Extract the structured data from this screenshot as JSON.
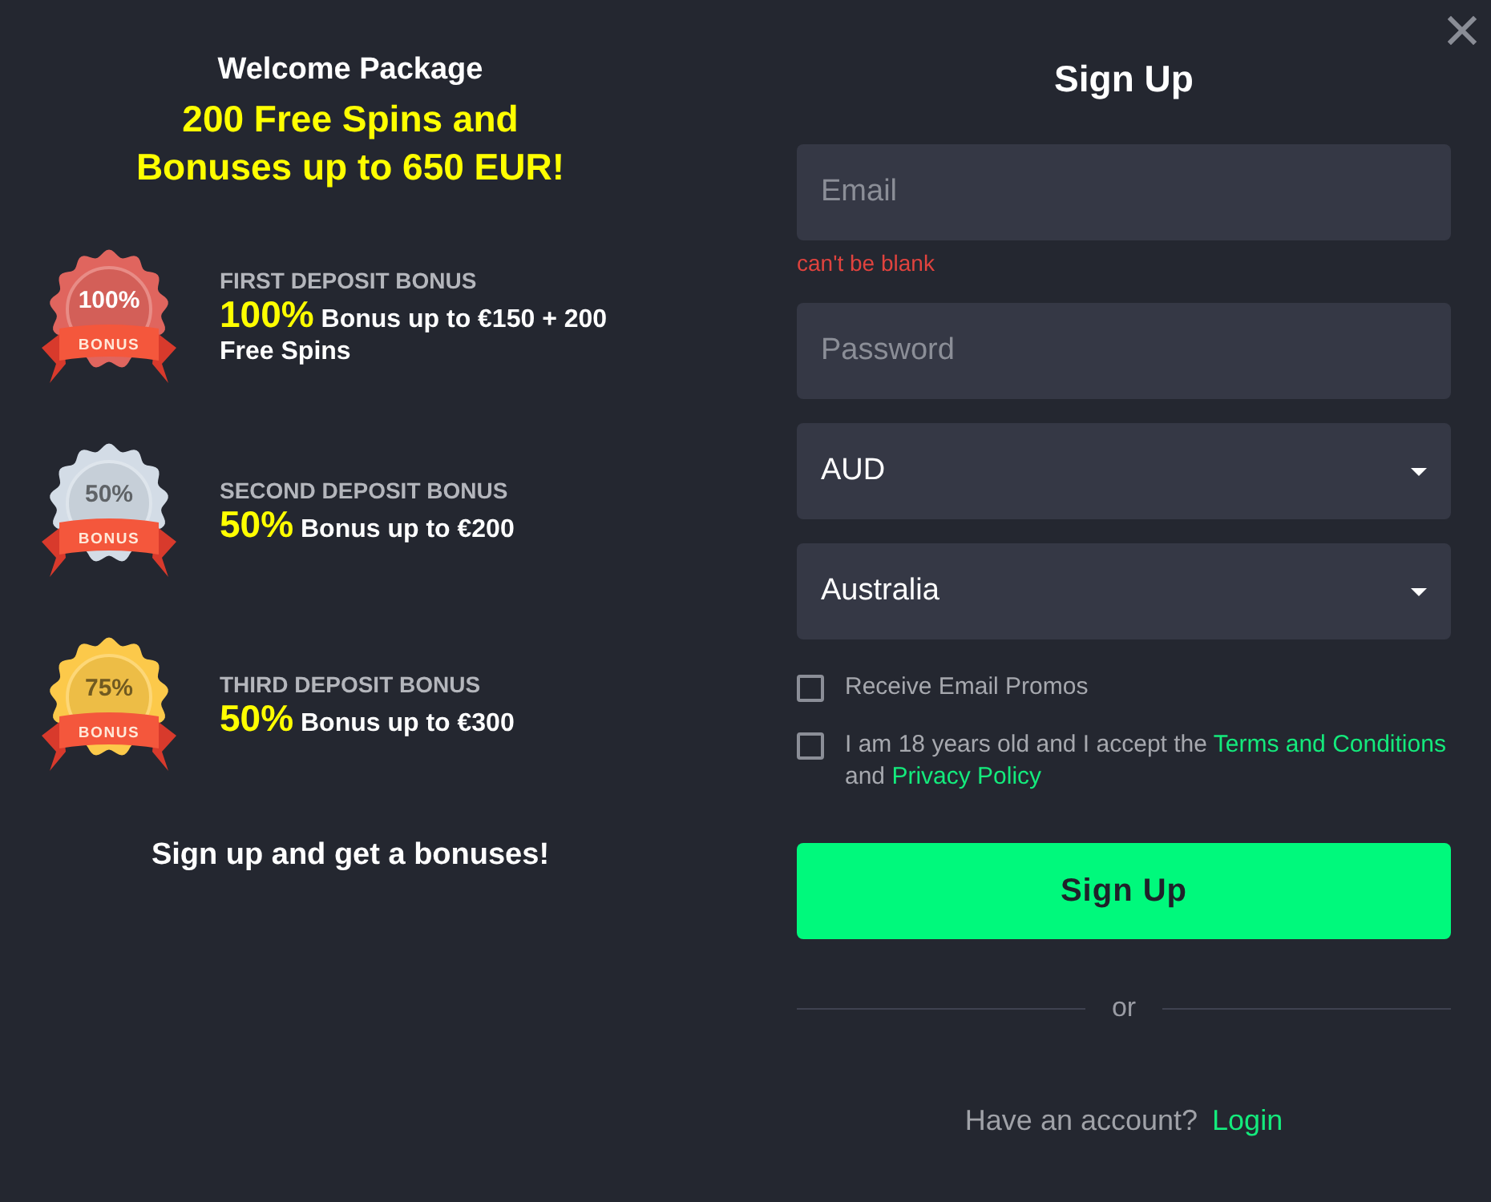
{
  "promo": {
    "title": "Welcome Package",
    "headline": [
      "200 Free Spins and",
      "Bonuses up to 650 EUR!"
    ],
    "bonuses": [
      {
        "badge": "100%",
        "ribbon": "BONUS",
        "color": "#e0655e",
        "heading": "FIRST DEPOSIT BONUS",
        "offer": "**100%** Bonus up to €150 + 200 Free Spins"
      },
      {
        "badge": "50%",
        "ribbon": "BONUS",
        "color": "#d3dce6",
        "heading": "SECOND DEPOSIT BONUS",
        "offer": "**50%** Bonus up to €200"
      },
      {
        "badge": "75%",
        "ribbon": "BONUS",
        "color": "#fcc94a",
        "heading": "THIRD DEPOSIT BONUS",
        "offer": "**50%** Bonus up to €300"
      }
    ],
    "footer": "Sign up and get a bonuses!"
  },
  "signup": {
    "title": "Sign Up",
    "email": {
      "placeholder": "Email",
      "error": "can't be blank"
    },
    "password": {
      "placeholder": "Password"
    },
    "currency": {
      "value": "AUD"
    },
    "country": {
      "value": "Australia"
    },
    "checkboxes": [
      {
        "checked": false,
        "label": [
          {
            "kind": "text",
            "text": "Receive Email Promos"
          }
        ]
      },
      {
        "checked": false,
        "label": [
          {
            "kind": "text",
            "text": "I am 18 years old and I accept the "
          },
          {
            "kind": "link",
            "text": "Terms and Conditions"
          },
          {
            "kind": "text",
            "text": " and "
          },
          {
            "kind": "link",
            "text": "Privacy Policy"
          }
        ]
      }
    ],
    "submit": "Sign Up",
    "divider": "or",
    "login_prompt": "Have an account?",
    "login_link": "Login"
  }
}
